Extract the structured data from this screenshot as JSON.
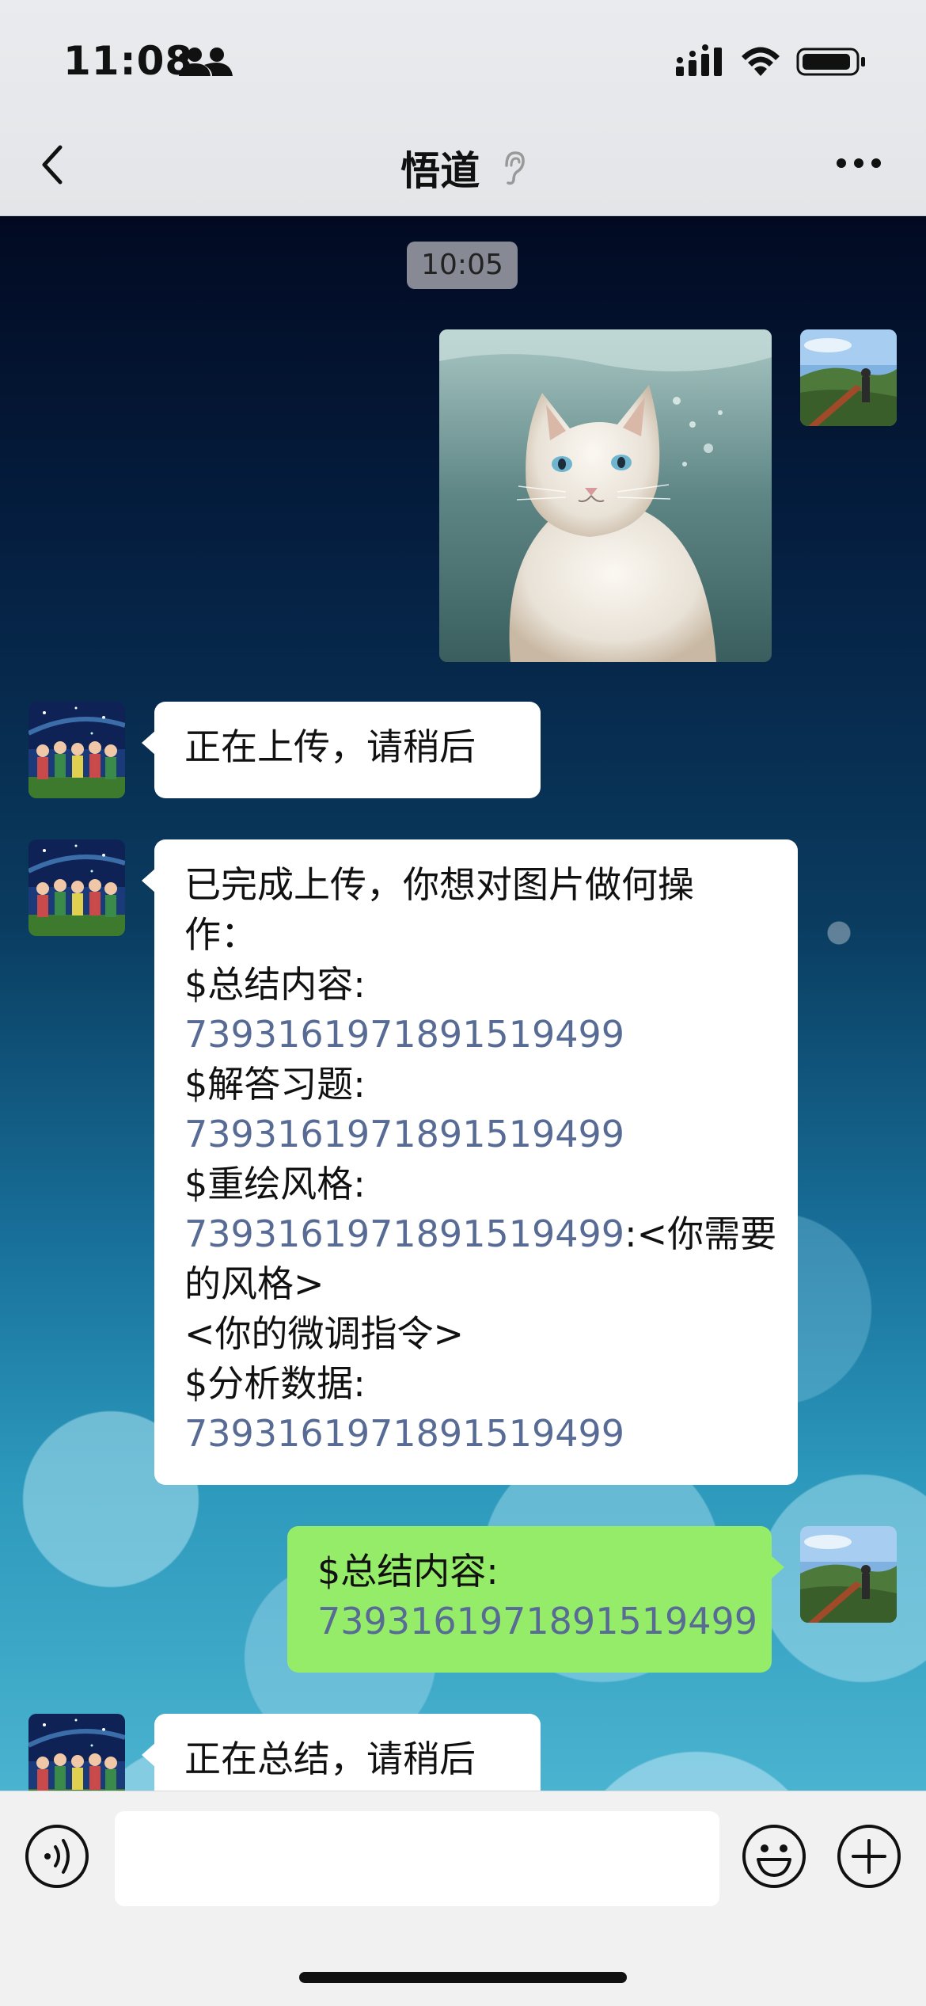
{
  "status_bar": {
    "time": "11:08"
  },
  "nav": {
    "title": "悟道"
  },
  "messages": [
    {
      "type": "timestamp",
      "text": "10:05"
    },
    {
      "type": "image",
      "sender": "me",
      "content": "cat photo"
    },
    {
      "type": "text",
      "sender": "bot",
      "text": "正在上传，请稍后"
    },
    {
      "type": "text",
      "sender": "bot",
      "lines": [
        "已完成上传，你想对图片做何操",
        "作：",
        "$总结内容:",
        "7393161971891519499",
        "$解答习题:",
        "7393161971891519499",
        "$重绘风格:",
        "7393161971891519499",
        ":<你需要",
        "的风格>",
        "<你的微调指令>",
        "$分析数据:",
        "7393161971891519499"
      ]
    },
    {
      "type": "text",
      "sender": "me",
      "lines": [
        "$总结内容:",
        "7393161971891519499"
      ]
    },
    {
      "type": "text",
      "sender": "bot",
      "text": "正在总结，请稍后"
    }
  ],
  "colors": {
    "bubble_me": "#95ec69",
    "bubble_other": "#ffffff",
    "link": "#576b95"
  }
}
